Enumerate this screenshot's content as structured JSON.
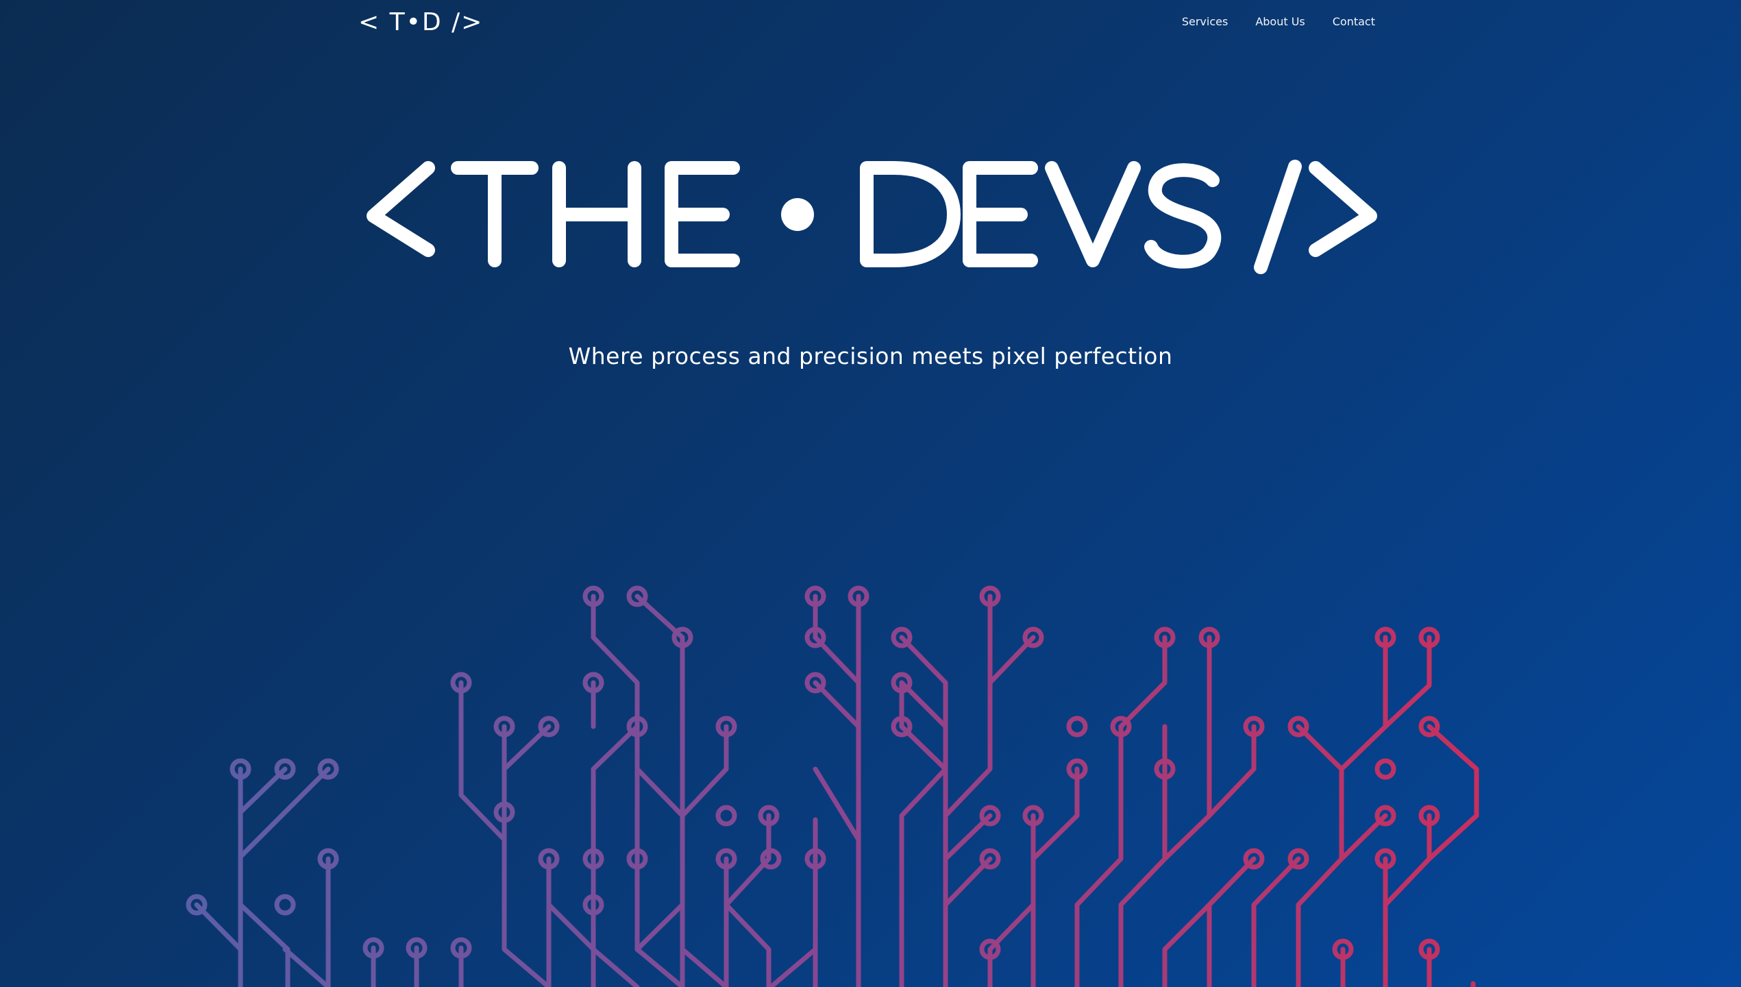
{
  "header": {
    "logo": "< T•D />",
    "nav": [
      "Services",
      "About Us",
      "Contact"
    ]
  },
  "hero": {
    "title": "<THE • DEVS/>",
    "subtitle": "Where process and precision meets pixel perfection"
  },
  "colors": {
    "background_start": "#0b2c52",
    "background_end": "#05479c",
    "circuit_start": "#5b5fa8",
    "circuit_end": "#c92f5d",
    "text": "#ffffff"
  },
  "decoration": {
    "name": "circuit-tree-illustration"
  }
}
